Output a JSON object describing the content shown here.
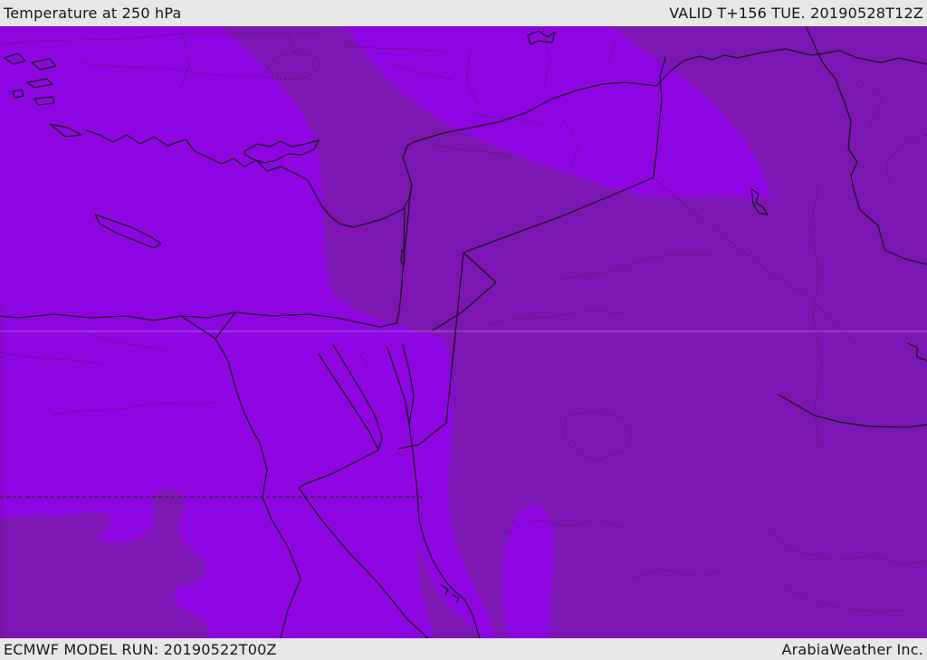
{
  "header": {
    "title": "Temperature at 250 hPa",
    "valid_label": "VALID T+156 TUE. 20190528T12Z"
  },
  "footer": {
    "model_run_label": "ECMWF MODEL RUN: 20190522T00Z",
    "attribution": "ArabiaWeather Inc."
  },
  "map": {
    "parameter": "Temperature at 250 hPa",
    "model": "ECMWF",
    "model_run": "20190522T00Z",
    "valid_time": "20190528T12Z",
    "lead_time": "T+156",
    "colors": {
      "temp_band_bright": "#8d05e0",
      "temp_band_dark": "#7c16b2",
      "coastline": "#141414",
      "faint_gridline": "#b277e2",
      "bar_background": "#e7e7e7",
      "bar_text": "#171717"
    }
  }
}
